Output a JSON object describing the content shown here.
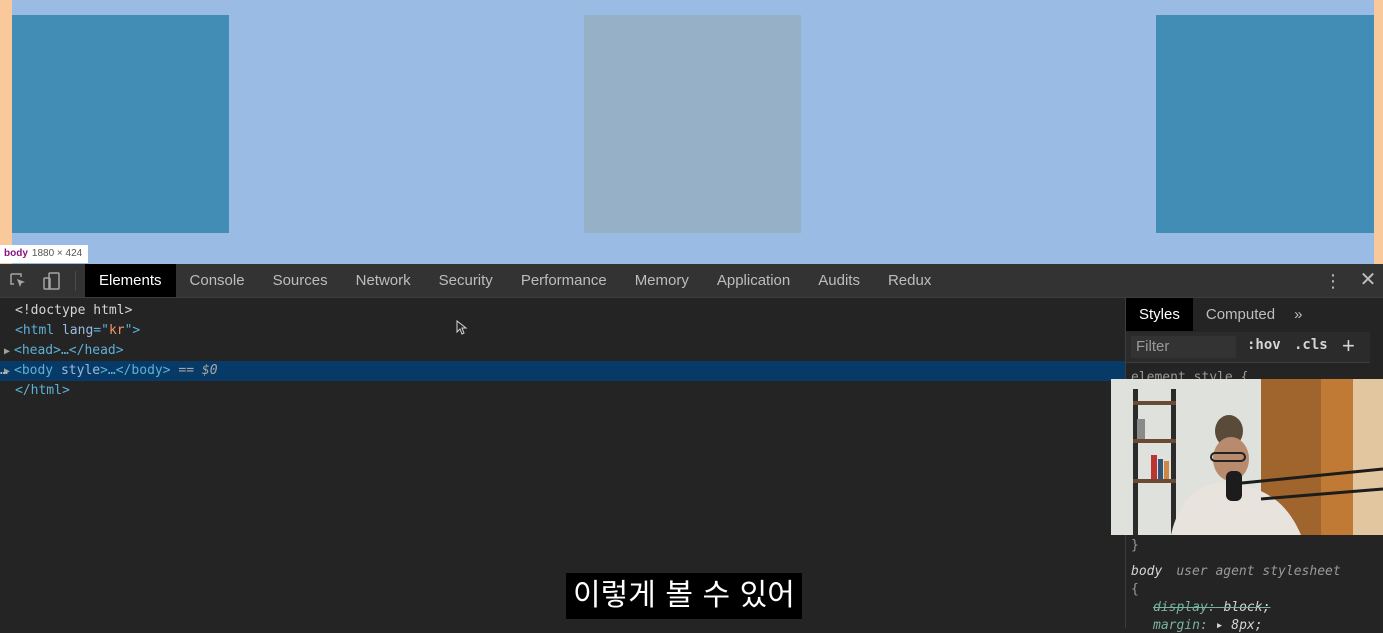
{
  "viewport": {
    "tooltip": {
      "tag": "body",
      "size": "1880 × 424"
    },
    "colors": {
      "margin": "#f9c89b",
      "body": "#99bbe4",
      "box_dark": "#418db6",
      "box_muted": "#95b0c7"
    }
  },
  "devtools": {
    "tabs": [
      "Elements",
      "Console",
      "Sources",
      "Network",
      "Security",
      "Performance",
      "Memory",
      "Application",
      "Audits",
      "Redux"
    ],
    "active_tab": "Elements",
    "icons": {
      "inspect": "inspect-element-icon",
      "device": "device-toolbar-icon",
      "menu": "kebab-menu-icon",
      "close": "close-icon"
    },
    "dom": {
      "doctype": "<!doctype html>",
      "html_open_tag": "<html",
      "html_attr": "lang",
      "html_attr_eq": "=\"",
      "html_attr_val": "kr",
      "html_open_end": "\">",
      "head_line": "<head>…</head>",
      "body_open": "<body",
      "body_attr": "style",
      "body_rest": ">…</body>",
      "body_marker": "==",
      "body_ref": "$0",
      "html_close": "</html>",
      "ellipsis": "…"
    },
    "styles": {
      "tabs": [
        "Styles",
        "Computed"
      ],
      "more": "»",
      "filter_placeholder": "Filter",
      "hov": ":hov",
      "cls": ".cls",
      "plus": "+",
      "element_style": "element.style {",
      "close_brace": "}",
      "rule_selector": "body",
      "rule_source": "user agent stylesheet",
      "open_brace": "{",
      "decl1_prop": "display:",
      "decl1_val": "block;",
      "decl2_prop": "margin:",
      "decl2_val": "▸ 8px;"
    }
  },
  "subtitle": "이렇게 볼 수 있어"
}
